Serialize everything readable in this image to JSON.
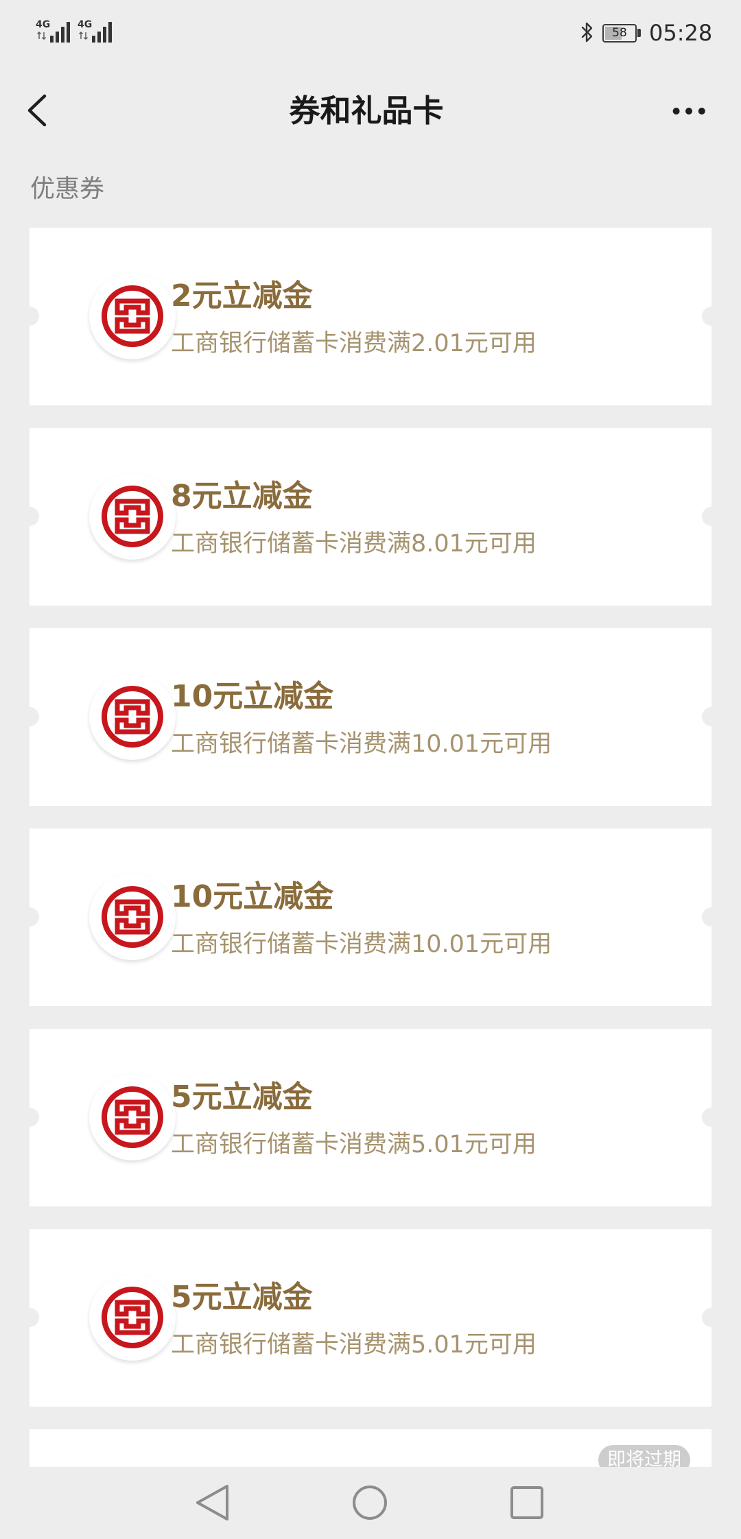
{
  "status_bar": {
    "sim1_network": "4G",
    "sim2_network": "4G",
    "signal_icon": "signal-bars-icon",
    "bluetooth_icon": "bluetooth-icon",
    "battery_level": "58",
    "time": "05:28"
  },
  "header": {
    "title": "券和礼品卡",
    "back_icon": "chevron-left-icon",
    "more_icon": "more-horizontal-icon"
  },
  "section": {
    "label": "优惠券"
  },
  "coupons": [
    {
      "title": "2元立减金",
      "description": "工商银行储蓄卡消费满2.01元可用",
      "logo": "icbc-logo-icon"
    },
    {
      "title": "8元立减金",
      "description": "工商银行储蓄卡消费满8.01元可用",
      "logo": "icbc-logo-icon"
    },
    {
      "title": "10元立减金",
      "description": "工商银行储蓄卡消费满10.01元可用",
      "logo": "icbc-logo-icon"
    },
    {
      "title": "10元立减金",
      "description": "工商银行储蓄卡消费满10.01元可用",
      "logo": "icbc-logo-icon"
    },
    {
      "title": "5元立减金",
      "description": "工商银行储蓄卡消费满5.01元可用",
      "logo": "icbc-logo-icon"
    },
    {
      "title": "5元立减金",
      "description": "工商银行储蓄卡消费满5.01元可用",
      "logo": "icbc-logo-icon"
    }
  ],
  "partial_coupon": {
    "badge": "即将过期"
  },
  "nav_bar": {
    "back_icon": "triangle-back-icon",
    "home_icon": "circle-home-icon",
    "recents_icon": "square-recents-icon"
  },
  "theme": {
    "background": "#EDEDED",
    "coupon_title": "#8A6C3C",
    "coupon_description": "#A6936E",
    "logo_red": "#C8161D",
    "badge": "#CDCDCD",
    "nav_icon": "#8C8C8C"
  }
}
